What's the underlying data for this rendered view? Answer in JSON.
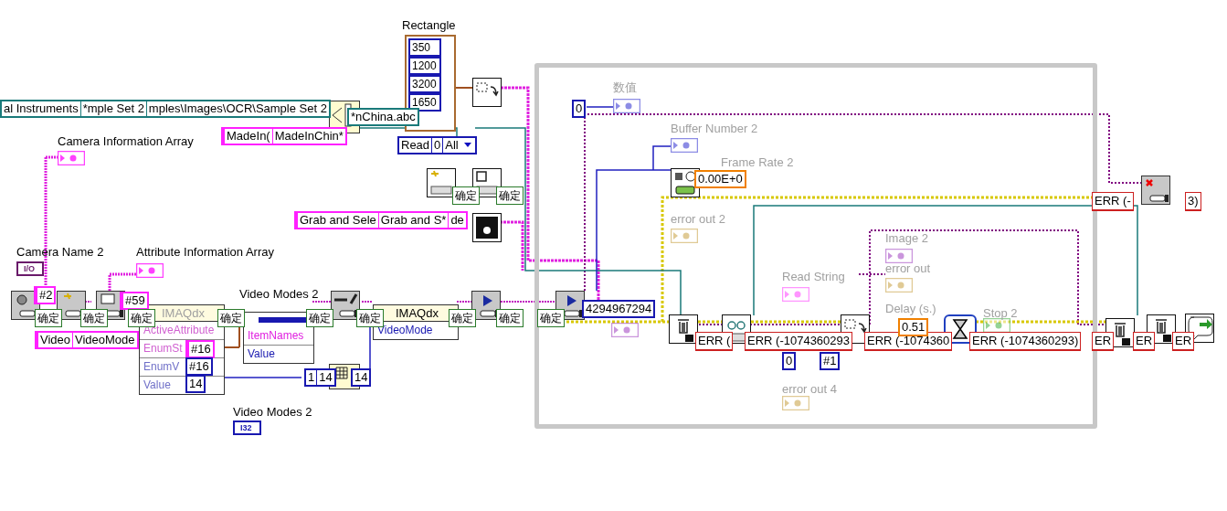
{
  "labels": [
    {
      "text": "Rectangle",
      "faded": false
    },
    {
      "text": "Camera Information Array",
      "faded": false
    },
    {
      "text": "Camera Name 2",
      "faded": false
    },
    {
      "text": "Attribute Information Array",
      "faded": false
    },
    {
      "text": "Video Modes 2",
      "faded": false
    },
    {
      "text": "Video Modes 2",
      "faded": false
    },
    {
      "text": "数值",
      "faded": true
    },
    {
      "text": "Buffer Number 2",
      "faded": true
    },
    {
      "text": "Frame Rate 2",
      "faded": true
    },
    {
      "text": "error out 2",
      "faded": true
    },
    {
      "text": "Read String",
      "faded": true
    },
    {
      "text": "Image 2",
      "faded": true
    },
    {
      "text": "error out",
      "faded": true
    },
    {
      "text": "Delay (s.)",
      "faded": true
    },
    {
      "text": "Stop 2",
      "faded": true
    },
    {
      "text": "error out 4",
      "faded": true
    }
  ],
  "constants": [
    {
      "kind": "numeric_array",
      "parts": [
        "350",
        "1200",
        "3200",
        "1650"
      ]
    },
    {
      "kind": "path",
      "parts": [
        "al Instruments",
        "*mple Set 2",
        "mples\\Images\\OCR\\Sample Set 2"
      ]
    },
    {
      "kind": "path",
      "parts": [
        "*nChina.abc"
      ]
    },
    {
      "kind": "string",
      "parts": [
        "MadeIn(",
        "MadeInChin*"
      ]
    },
    {
      "kind": "enum",
      "parts": [
        "Read",
        "0",
        "All"
      ]
    },
    {
      "kind": "string",
      "parts": [
        "Grab and Sele",
        "Grab and S*",
        "de"
      ]
    },
    {
      "kind": "string",
      "parts": [
        "#2"
      ]
    },
    {
      "kind": "string",
      "parts": [
        "#59"
      ]
    },
    {
      "kind": "string",
      "parts": [
        "Video",
        "VideoMode"
      ]
    },
    {
      "kind": "string",
      "parts": [
        "#16"
      ]
    },
    {
      "kind": "numeric",
      "parts": [
        "#16"
      ]
    },
    {
      "kind": "numeric",
      "parts": [
        "14"
      ]
    },
    {
      "kind": "numeric",
      "parts": [
        "1",
        "14"
      ]
    },
    {
      "kind": "numeric",
      "parts": [
        "14"
      ]
    },
    {
      "kind": "numeric",
      "parts": [
        "0"
      ]
    },
    {
      "kind": "float",
      "parts": [
        "0.00E+0"
      ]
    },
    {
      "kind": "numeric",
      "parts": [
        "4294967294"
      ]
    },
    {
      "kind": "error",
      "parts": [
        "ERR ("
      ]
    },
    {
      "kind": "error",
      "parts": [
        "ERR (-1074360293"
      ]
    },
    {
      "kind": "error",
      "parts": [
        "ERR (-1074360"
      ]
    },
    {
      "kind": "error",
      "parts": [
        "ERR (-1074360293)"
      ]
    },
    {
      "kind": "error",
      "parts": [
        "ERR (-"
      ]
    },
    {
      "kind": "error",
      "parts": [
        "3)"
      ]
    },
    {
      "kind": "error",
      "parts": [
        "ER"
      ]
    },
    {
      "kind": "error",
      "parts": [
        "ER"
      ]
    },
    {
      "kind": "error",
      "parts": [
        "ER"
      ]
    },
    {
      "kind": "float",
      "parts": [
        "0.51"
      ]
    },
    {
      "kind": "numeric",
      "parts": [
        "0"
      ]
    },
    {
      "kind": "numeric",
      "parts": [
        "#1"
      ]
    },
    {
      "kind": "status",
      "parts": [
        "确定"
      ]
    },
    {
      "kind": "status",
      "parts": [
        "确定"
      ]
    },
    {
      "kind": "status",
      "parts": [
        "确定"
      ]
    },
    {
      "kind": "status",
      "parts": [
        "确定"
      ]
    },
    {
      "kind": "status",
      "parts": [
        "确定"
      ]
    },
    {
      "kind": "status",
      "parts": [
        "确定"
      ]
    },
    {
      "kind": "status",
      "parts": [
        "确定"
      ]
    },
    {
      "kind": "status",
      "parts": [
        "确定"
      ]
    },
    {
      "kind": "status",
      "parts": [
        "确定"
      ]
    },
    {
      "kind": "status",
      "parts": [
        "确定"
      ]
    },
    {
      "kind": "status",
      "parts": [
        "确定"
      ]
    }
  ],
  "terminals": [
    {
      "text": "I/O",
      "kind": "refnum"
    },
    {
      "text": "I32",
      "kind": "numeric"
    }
  ],
  "property_nodes": [
    {
      "header": "IMAQdx",
      "faded": true,
      "rows": [
        {
          "text": "ActiveAttribute",
          "kind": "string"
        },
        {
          "text": "EnumSt",
          "kind": "string"
        },
        {
          "text": "EnumV",
          "kind": "numeric"
        },
        {
          "text": "Value",
          "kind": "numeric"
        }
      ]
    },
    {
      "faded": false,
      "rows": [
        {
          "text": "ItemNames",
          "kind": "string"
        },
        {
          "text": "Value",
          "kind": "numeric"
        }
      ]
    },
    {
      "header": "IMAQdx",
      "faded": false,
      "rows": [
        {
          "text": "VideoMode",
          "kind": "numeric"
        }
      ]
    }
  ]
}
